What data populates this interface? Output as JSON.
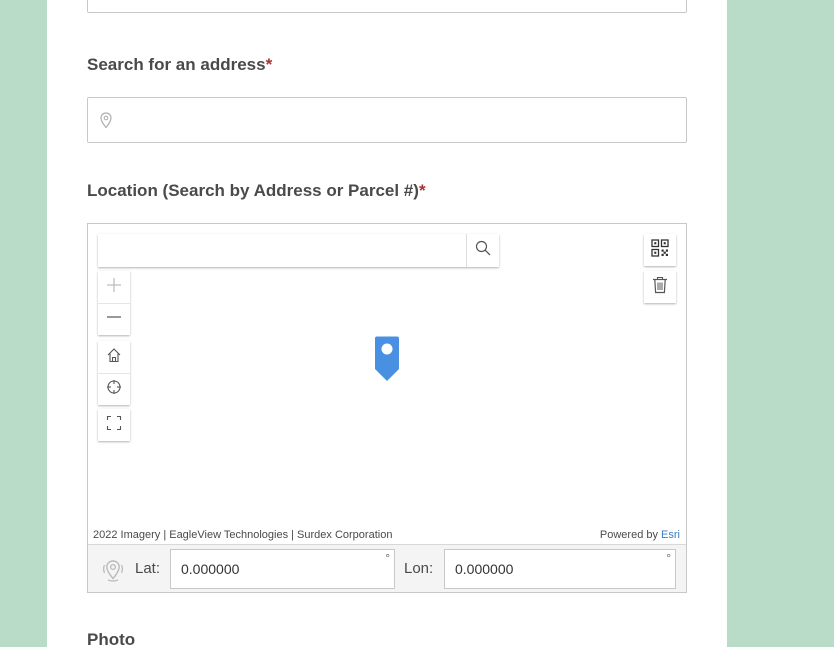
{
  "form": {
    "address_label": "Search for an address",
    "required_mark": "*",
    "address_placeholder": "",
    "location_label": "Location (Search by Address or Parcel #)",
    "photo_label": "Photo"
  },
  "map": {
    "search_placeholder": "",
    "attribution_text": "2022 Imagery | EagleView Technologies | Surdex Corporation",
    "powered_by": "Powered by",
    "esri_link": "Esri",
    "icons": {
      "search": "search-icon",
      "zoom_in": "plus-icon",
      "zoom_out": "minus-icon",
      "home": "home-icon",
      "locate": "crosshair-icon",
      "fullscreen": "fullscreen-icon",
      "qr": "qr-code-icon",
      "trash": "trash-icon",
      "marker": "map-pin-icon",
      "gps": "gps-location-icon"
    },
    "marker_color": "#4a90e2"
  },
  "coords": {
    "lat_label": "Lat:",
    "lat_value": "0.000000",
    "lon_label": "Lon:",
    "lon_value": "0.000000",
    "degree_symbol": "°"
  },
  "colors": {
    "page_background": "#b8dcc7",
    "required": "#a83232",
    "link": "#3b7bc2"
  }
}
